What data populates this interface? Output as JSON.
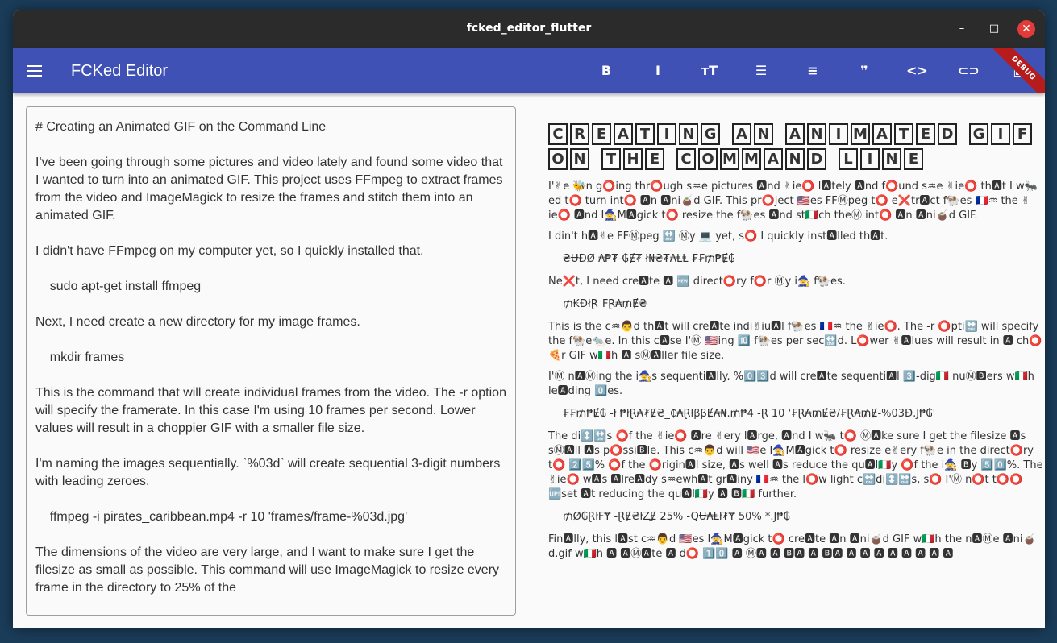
{
  "window": {
    "title": "fcked_editor_flutter",
    "controls": {
      "minimize": "–",
      "maximize": "□",
      "close": "✕"
    }
  },
  "appbar": {
    "title": "FCKed Editor",
    "debug_banner": "DEBUG",
    "colors": {
      "appbar": "#3f51b5",
      "debug": "#b71c1c"
    },
    "toolbar": [
      {
        "icon": "format-bold-icon",
        "glyph": "B"
      },
      {
        "icon": "format-italic-icon",
        "glyph": "I"
      },
      {
        "icon": "format-size-icon",
        "glyph": "тT"
      },
      {
        "icon": "bulleted-list-icon",
        "glyph": "☰"
      },
      {
        "icon": "numbered-list-icon",
        "glyph": "≡"
      },
      {
        "icon": "format-quote-icon",
        "glyph": "❞"
      },
      {
        "icon": "code-icon",
        "glyph": "<>"
      },
      {
        "icon": "link-icon",
        "glyph": "⊂⊃"
      },
      {
        "icon": "image-icon",
        "glyph": "▣"
      }
    ]
  },
  "editor": {
    "content": "# Creating an Animated GIF on the Command Line\n\nI've been going through some pictures and video lately and found some video that I wanted to turn into an animated GIF. This project uses FFmpeg to extract frames from the video and ImageMagick to resize the frames and stitch them into an animated GIF.\n\nI didn't have FFmpeg on my computer yet, so I quickly installed that.\n\n    sudo apt-get install ffmpeg\n\nNext, I need create a new directory for my image frames.\n\n    mkdir frames\n\nThis is the command that will create individual frames from the video. The -r option will specify the framerate. In this case I'm using 10 frames per second. Lower values will result in a choppier GIF with a smaller file size.\n\nI'm naming the images sequentially. `%03d` will create sequential 3-digit numbers with leading zeroes.\n\n    ffmpeg -i pirates_caribbean.mp4 -r 10 'frames/frame-%03d.jpg'\n\nThe dimensions of the video are very large, and I want to make sure I get the filesize as small as possible. This command will use ImageMagick to resize every frame in the directory to 25% of the"
  },
  "preview": {
    "heading_words": [
      "CREATING",
      "AN",
      "ANIMATED",
      "GIF",
      "ON",
      "THE",
      "COMMAND",
      "LINE"
    ],
    "blocks": [
      {
        "type": "para",
        "text": "I'✌e 🐝n g⭕in͏g thr⭕ugh s♒e pictures 🅰nd ✌i͏e⭕ l🅰tely 🅰nd f⭕und s♒e ✌i͏e⭕ th🅰t I w🐜ed t⭕ turn int⭕ 🅰n 🅰ni🧉d GIF. This pr⭕ject 🇺🇸es FFⓂpeg t⭕ e❌tr🅰ct f🐏es 🇫🇷♒ the ✌i͏e⭕ 🅰nd I🧙M🅰gick t⭕ resize the f🐏es 🅰nd st🇮🇹ch theⓂ int⭕ 🅰n 🅰ni🧉d GIF."
      },
      {
        "type": "para",
        "text": "I d͏i͏n't h🅰✌e FFⓂpeg 🔛 Ⓜy 💻 yet, s⭕ I quickly inst🅰lled th🅰t."
      },
      {
        "type": "code",
        "text": "₴ɄĐØ ₳₱₮-₲Ɇ₮ ł₦₴₮₳ⱠⱠ ₣₣₥₱Ɇ₲"
      },
      {
        "type": "para",
        "text": "Ne❌t, I need cre🅰te 🅰 🆕 direct⭕ry f⭕r Ⓜy i🧙 f🐏es."
      },
      {
        "type": "code",
        "text": "₥₭ĐłⱤ ₣Ɽ₳₥Ɇ₴"
      },
      {
        "type": "para",
        "text": "This is the c♒👨d th🅰t will cre🅰te indi✌i͏u🅰l f🐏es 🇫🇷♒ the ✌i͏e⭕. The -r ⭕pti🔛 will specify the f🐏e🐀e. In this c🅰se I'Ⓜ 🇺🇸in͏g 🔟 f🐏es per sec🔛d. L⭕wer ✌🅰lues will result in 🅰 ch⭕🍕r GIF w🇮🇹h 🅰 sⓂ🅰ller file size."
      },
      {
        "type": "para",
        "text": "I'Ⓜ n🅰Ⓜin͏g the i🧙s sequenti🅰lly. %0️⃣3️⃣d will cre🅰te sequenti🅰l 3️⃣-dig🇮🇹 nuⓂ🅱ers w🇮🇹h le🅰din͏g 0️⃣es."
      },
      {
        "type": "code",
        "text": "₣₣₥₱Ɇ₲ -ł ₱łⱤ₳₮Ɇ₴_₵₳ⱤłββɆ₳₦.₥₱4 -Ɽ 10 '₣Ɽ₳₥Ɇ₴/₣Ɽ₳₥Ɇ-%03Đ.J₱₲'"
      },
      {
        "type": "para",
        "text": "The di↕️🔛s ⭕f the ✌i͏e⭕ 🅰re ✌ery l🅰rge, 🅰nd I w🐜 t⭕ Ⓜ🅰ke sure I get the filesize 🅰s sⓂ🅰ll 🅰s p⭕ssi🅱le. This c♒👨d will 🇺🇸e I🧙M🅰gick t⭕ resize e✌ery f🐏e in the direct⭕ry t⭕ 2️⃣5️⃣% ⭕f the ⭕rigin🅰l size, 🅰s well 🅰s reduce the qu🅰l🇮🇹y ⭕f the i🧙 🅱y 5️⃣0️⃣%. The ✌i͏e⭕ w🅰s 🅰lre🅰dy s♒ewh🅰t gr🅰iny 🇫🇷♒ the l⭕w light c🔛di↕️🔛s, s⭕ I'Ⓜ n⭕t t⭕⭕ 🆙set 🅰t reducin͏g the qu🅰l🇮🇹y 🅰 🅱🇮🇹 further."
      },
      {
        "type": "code",
        "text": "₥Ø₲ⱤłFɎ -ⱤɆ₴łⱫɆ 25% -QɄ₳Ⱡł₮Ɏ 50% *.J₱₲"
      },
      {
        "type": "para",
        "text": "Fin🅰lly, this l🅰st c♒👨d 🇺🇸es I🧙M🅰gick t⭕ cre🅰te 🅰n 🅰ni🧉d GIF w🇮🇹h the n🅰Ⓜe 🅰ni🧉d.gif w🇮🇹h 🅰 🅰Ⓜ🅰te 🅰 d⭕ 1️⃣0️⃣ 🅰 Ⓜ🅰 🅰 🅱🅰 🅰 🅱🅰 🅰 🅰 🅰 🅰 🅰 🅰 🅰 🅰"
      }
    ]
  }
}
